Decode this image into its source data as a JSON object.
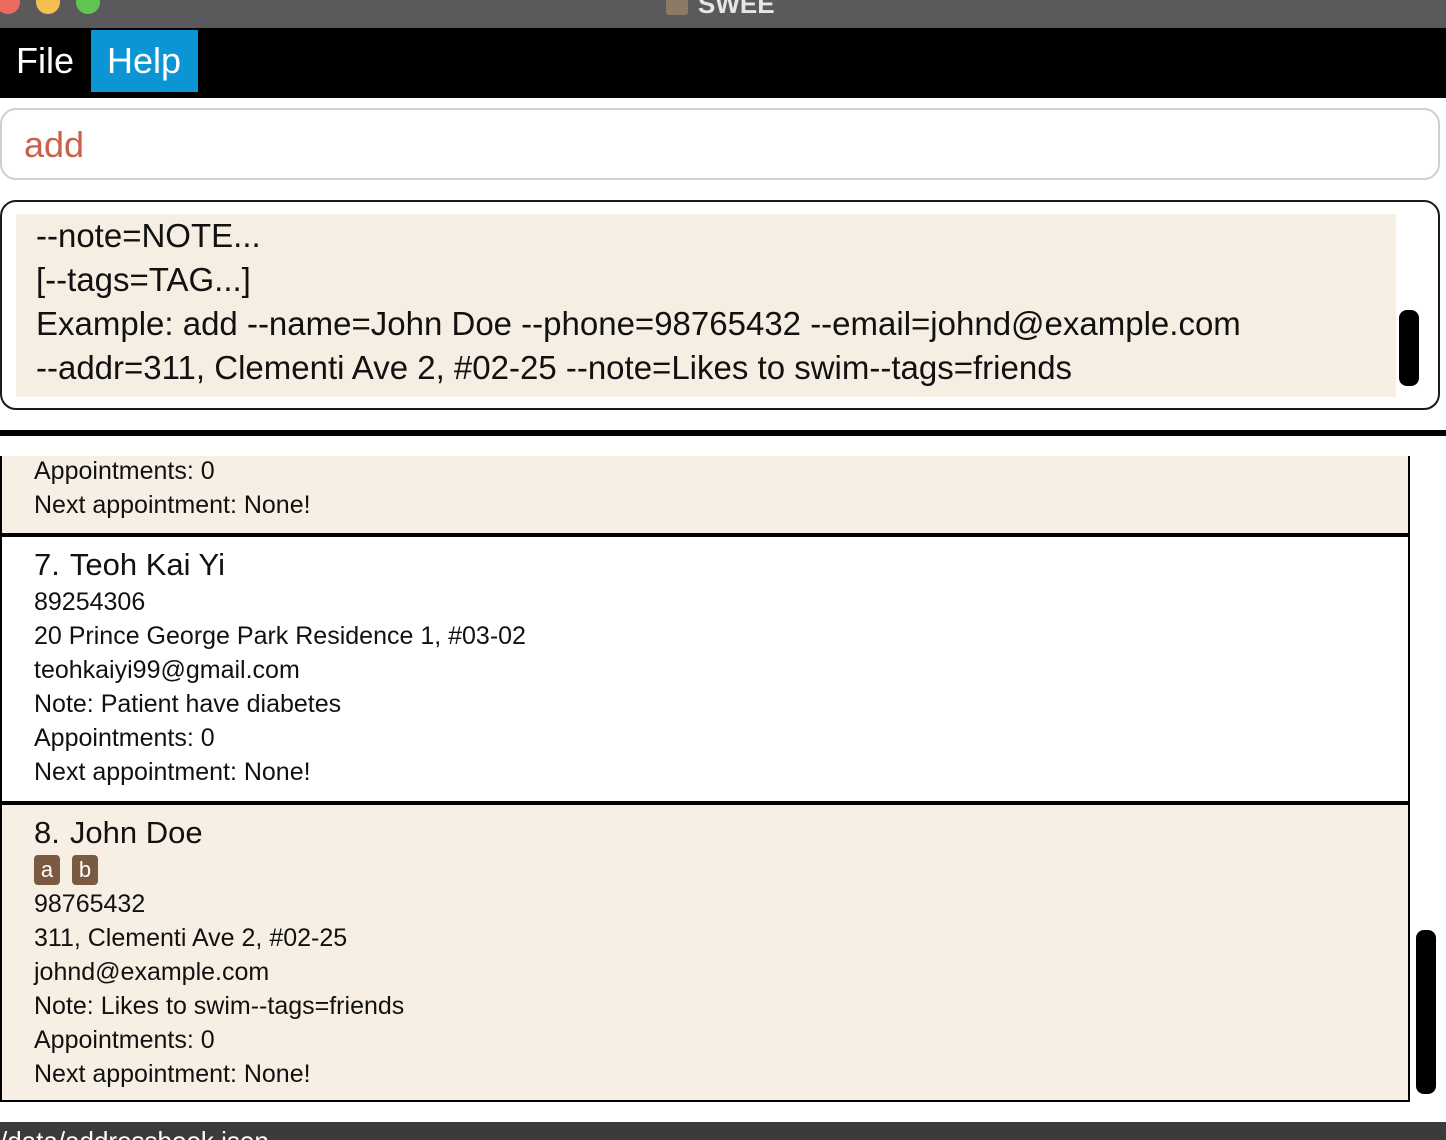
{
  "window": {
    "title": "SWEE"
  },
  "menu": {
    "file_label": "File",
    "help_label": "Help"
  },
  "command": {
    "value": "add"
  },
  "result": {
    "lines": [
      "--note=NOTE...",
      "[--tags=TAG...]",
      "Example: add --name=John Doe --phone=98765432 --email=johnd@example.com",
      "--addr=311, Clementi Ave 2, #02-25 --note=Likes to swim--tags=friends"
    ]
  },
  "patients": [
    {
      "appointments": "Appointments: 0",
      "next": "Next appointment: None!"
    },
    {
      "index": "7.",
      "name": "Teoh Kai Yi",
      "phone": "89254306",
      "address": "20 Prince George Park Residence 1, #03-02",
      "email": "teohkaiyi99@gmail.com",
      "note": "Note: Patient have diabetes",
      "appointments": "Appointments: 0",
      "next": "Next appointment: None!"
    },
    {
      "index": "8.",
      "name": "John Doe",
      "tags": [
        "a",
        "b"
      ],
      "phone": "98765432",
      "address": "311, Clementi Ave 2, #02-25",
      "email": "johnd@example.com",
      "note": "Note: Likes to swim--tags=friends",
      "appointments": "Appointments: 0",
      "next": "Next appointment: None!"
    }
  ],
  "status": {
    "path": "/data/addressbook.json"
  }
}
